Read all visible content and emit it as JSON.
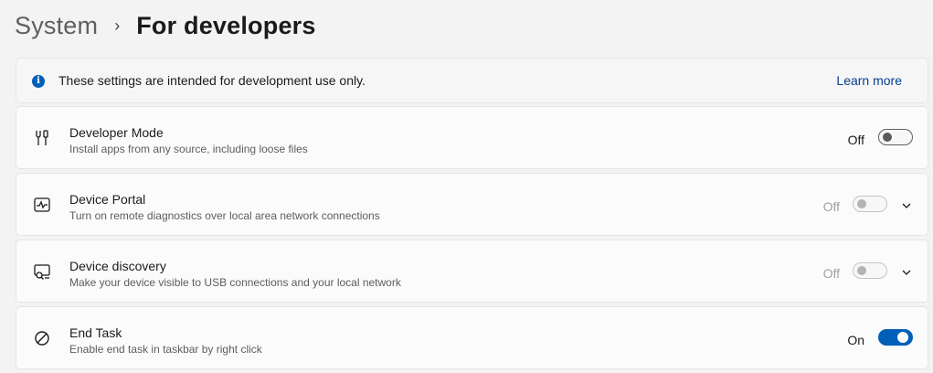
{
  "header": {
    "parent": "System",
    "separator": "›",
    "title": "For developers"
  },
  "info": {
    "icon_label": "i",
    "text": "These settings are intended for development use only.",
    "link": "Learn more"
  },
  "settings": [
    {
      "icon": "developer-tools-icon",
      "title": "Developer Mode",
      "description": "Install apps from any source, including loose files",
      "state": "Off",
      "enabled": true,
      "expandable": false
    },
    {
      "icon": "device-portal-icon",
      "title": "Device Portal",
      "description": "Turn on remote diagnostics over local area network connections",
      "state": "Off",
      "enabled": false,
      "expandable": true
    },
    {
      "icon": "device-discovery-icon",
      "title": "Device discovery",
      "description": "Make your device visible to USB connections and your local network",
      "state": "Off",
      "enabled": false,
      "expandable": true
    },
    {
      "icon": "end-task-icon",
      "title": "End Task",
      "description": "Enable end task in taskbar by right click",
      "state": "On",
      "enabled": true,
      "expandable": false
    }
  ],
  "colors": {
    "accent": "#005fb8",
    "link": "#003e92",
    "background": "#f3f3f3"
  }
}
